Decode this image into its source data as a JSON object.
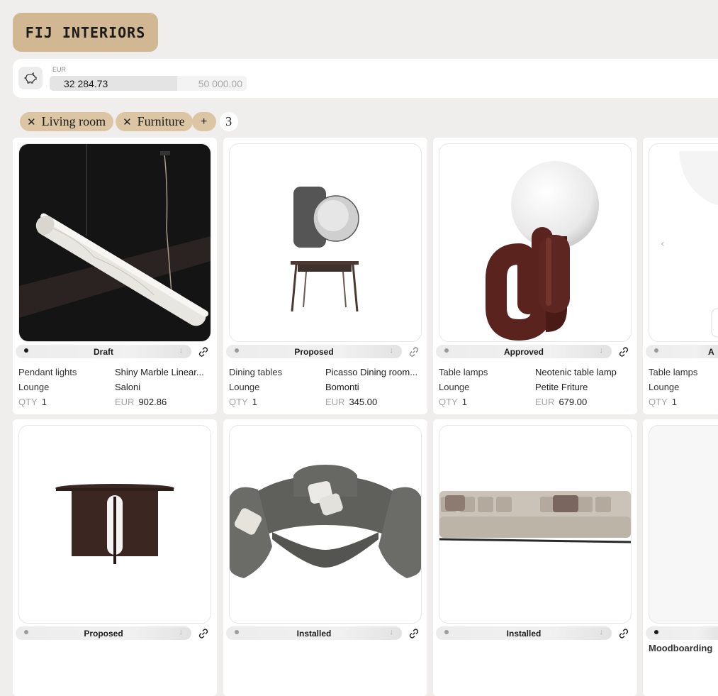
{
  "brand": {
    "name": "FIJ INTERIORS"
  },
  "budget": {
    "currency": "EUR",
    "spent": "32 284.73",
    "total": "50 000.00",
    "fill_fraction": 0.646
  },
  "filters": {
    "chips": [
      {
        "label": "Living room"
      },
      {
        "label": "Furniture"
      }
    ],
    "add_label": "+",
    "result_count": "3"
  },
  "cards": [
    {
      "status": "Draft",
      "category": "Pendant lights",
      "room": "Lounge",
      "qty_label": "QTY",
      "qty": "1",
      "name": "Shiny Marble Linear...",
      "brand": "Saloni",
      "price_currency": "EUR",
      "price": "902.86",
      "image": "marble-pendant-light"
    },
    {
      "status": "Proposed",
      "category": "Dining tables",
      "room": "Lounge",
      "qty_label": "QTY",
      "qty": "1",
      "name": "Picasso Dining room...",
      "brand": "Bomonti",
      "price_currency": "EUR",
      "price": "345.00",
      "image": "console-mirror"
    },
    {
      "status": "Approved",
      "category": "Table lamps",
      "room": "Lounge",
      "qty_label": "QTY",
      "qty": "1",
      "name": "Neotenic table lamp",
      "brand": "Petite Friture",
      "price_currency": "EUR",
      "price": "679.00",
      "image": "globe-table-lamp"
    },
    {
      "status": "A",
      "category": "Table lamps",
      "room": "Lounge",
      "qty_label": "QTY",
      "qty": "1",
      "image": "partial-lamp"
    },
    {
      "status": "Proposed",
      "image": "round-dining-table"
    },
    {
      "status": "Installed",
      "image": "curved-sofa"
    },
    {
      "status": "Installed",
      "image": "modular-sofa"
    },
    {
      "status": "",
      "category": "Moodboarding",
      "image": "blank"
    }
  ],
  "colors": {
    "brand": "#d2b793",
    "chip": "#dcc5a3",
    "background": "#efeeec"
  }
}
